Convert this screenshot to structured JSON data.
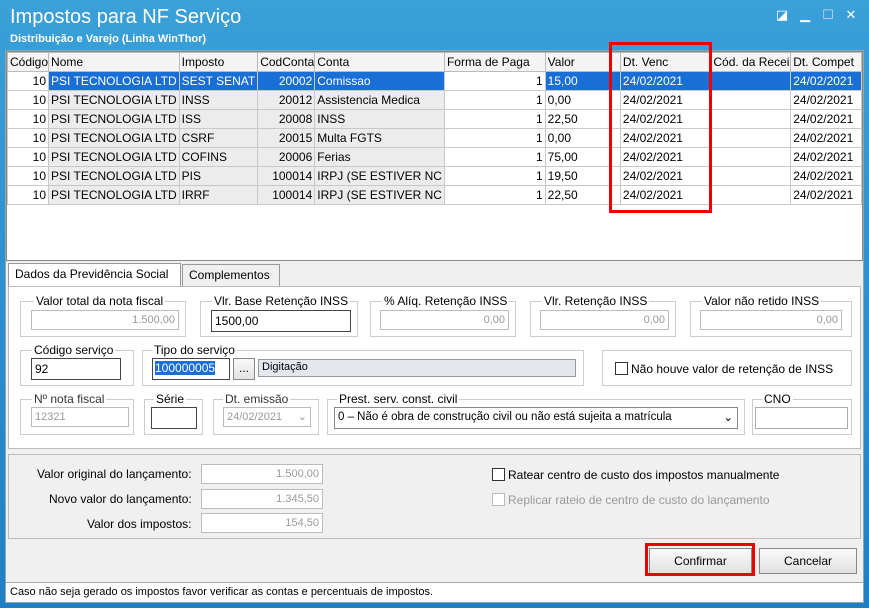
{
  "window": {
    "title": "Impostos para NF Serviço",
    "subtitle": "Distribuição e Varejo (Linha WinThor)"
  },
  "grid": {
    "headers": [
      "Código",
      "Nome",
      "Imposto",
      "CodConta",
      "Conta",
      "Forma de Paga",
      "Valor",
      "Dt. Venc",
      "Cód. da Recei",
      "Dt. Compet"
    ],
    "rows": [
      [
        "10",
        "PSI TECNOLOGIA LTD",
        "SEST SENAT",
        "20002",
        "Comissao",
        "1",
        "15,00",
        "24/02/2021",
        "",
        "24/02/2021"
      ],
      [
        "10",
        "PSI TECNOLOGIA LTD",
        "INSS",
        "20012",
        "Assistencia Medica",
        "1",
        "0,00",
        "24/02/2021",
        "",
        "24/02/2021"
      ],
      [
        "10",
        "PSI TECNOLOGIA LTD",
        "ISS",
        "20008",
        "INSS",
        "1",
        "22,50",
        "24/02/2021",
        "",
        "24/02/2021"
      ],
      [
        "10",
        "PSI TECNOLOGIA LTD",
        "CSRF",
        "20015",
        "Multa FGTS",
        "1",
        "0,00",
        "24/02/2021",
        "",
        "24/02/2021"
      ],
      [
        "10",
        "PSI TECNOLOGIA LTD",
        "COFINS",
        "20006",
        "Ferias",
        "1",
        "75,00",
        "24/02/2021",
        "",
        "24/02/2021"
      ],
      [
        "10",
        "PSI TECNOLOGIA LTD",
        "PIS",
        "100014",
        "IRPJ (SE ESTIVER NC",
        "1",
        "19,50",
        "24/02/2021",
        "",
        "24/02/2021"
      ],
      [
        "10",
        "PSI TECNOLOGIA LTD",
        "IRRF",
        "100014",
        "IRPJ (SE ESTIVER NC",
        "1",
        "22,50",
        "24/02/2021",
        "",
        "24/02/2021"
      ]
    ]
  },
  "tabs": [
    "Dados da Previdência Social",
    "Complementos"
  ],
  "form": {
    "valor_total_label": "Valor total da nota fiscal",
    "valor_total": "1.500,00",
    "base_label": "Vlr. Base Retenção INSS",
    "base": "1500,00",
    "aliq_label": "% Alíq. Retenção INSS",
    "aliq": "0,00",
    "ret_label": "Vlr. Retenção INSS",
    "ret": "0,00",
    "nao_retido_label": "Valor não retido INSS",
    "nao_retido": "0,00",
    "cod_serv_label": "Código serviço",
    "cod_serv": "92",
    "tipo_serv_label": "Tipo do serviço",
    "tipo_serv": "100000005",
    "tipo_serv_btn": "...",
    "tipo_serv_desc": "Digitação",
    "nao_houve_label": "Não houve valor de retenção de INSS",
    "nf_label": "Nº nota fiscal",
    "nf": "12321",
    "serie_label": "Série",
    "serie": "",
    "dt_emissao_label": "Dt. emissão",
    "dt_emissao": "24/02/2021",
    "prest_label": "Prest. serv. const. civil",
    "prest": "0 – Não é obra de construção civil ou não está sujeita a matrícula",
    "cno_label": "CNO",
    "cno": ""
  },
  "bottom": {
    "orig_label": "Valor original do lançamento:",
    "orig": "1.500,00",
    "novo_label": "Novo valor do lançamento:",
    "novo": "1.345,50",
    "imp_label": "Valor dos impostos:",
    "imp": "154,50",
    "ratear_label": "Ratear centro de custo dos impostos manualmente",
    "replicar_label": "Replicar rateio de centro de custo do lançamento"
  },
  "buttons": {
    "confirmar": "Confirmar",
    "cancelar": "Cancelar"
  },
  "status": "Caso não seja gerado os impostos favor verificar as contas e percentuais de impostos.",
  "colors": {
    "titlebar": "#2a8fd0",
    "selection": "#1a6fd6",
    "highlight": "#e00000"
  }
}
